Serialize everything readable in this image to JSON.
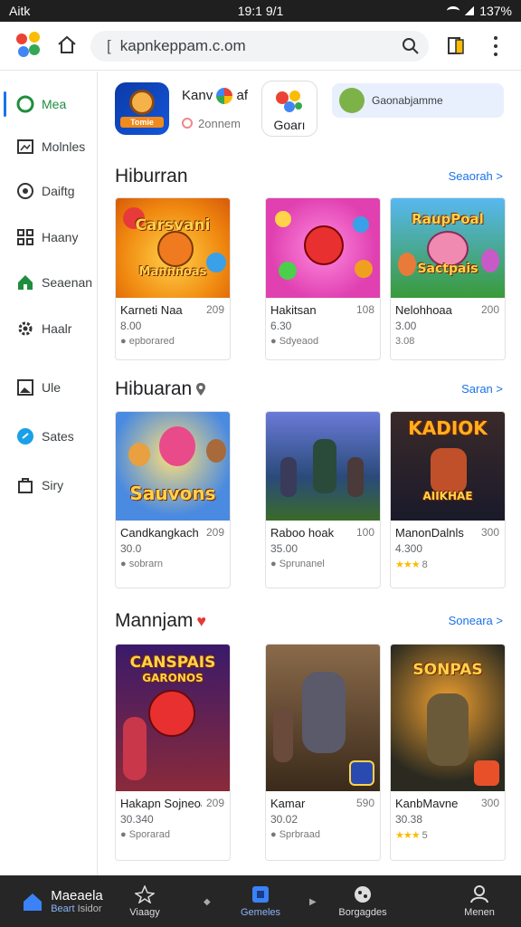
{
  "status": {
    "left": "Aitk",
    "time": "19:1 9/1",
    "battery": "137%"
  },
  "browser": {
    "url": "kapnkeppam.c.om",
    "url_cursor": "["
  },
  "sidebar": {
    "items": [
      {
        "label": "Mea",
        "icon": "circle-icon",
        "active": true
      },
      {
        "label": "Molnles",
        "icon": "image-icon"
      },
      {
        "label": "Daiftg",
        "icon": "target-icon"
      },
      {
        "label": "Haany",
        "icon": "grid-icon"
      },
      {
        "label": "Seaenan",
        "icon": "house-icon"
      },
      {
        "label": "Haalr",
        "icon": "gear-icon"
      },
      {
        "label": "Ule",
        "icon": "photo-icon"
      },
      {
        "label": "Sates",
        "icon": "blue-dot-icon"
      },
      {
        "label": "Siry",
        "icon": "bag-icon"
      }
    ]
  },
  "featured": {
    "app1_label": "Tomie",
    "title": "Kanv",
    "title_suffix": "af",
    "subtitle": "2onnem",
    "app2_label": "Goarı",
    "chip_text": "Gaonabjamme"
  },
  "sections": [
    {
      "title": "Hiburran",
      "link": "Seaorah >",
      "cards": [
        {
          "art_title": "Carsvani",
          "art_sub": "Mannnoas",
          "name": "Karneti Naa",
          "rank": "209",
          "price": "8.00",
          "tag": "● epborared",
          "bg": "#f4a014"
        },
        {
          "art_title": "",
          "art_sub": "",
          "name": "Hakitsan",
          "rank": "108",
          "price": "6.30",
          "tag": "● Sdyeaod",
          "bg": "#ee58c4"
        },
        {
          "art_title": "RaupPoal",
          "art_sub": "Sactpais",
          "name": "Nelohhoaa",
          "rank": "200",
          "price": "3.00",
          "tag": "3.08",
          "bg": "#48a8e0"
        }
      ]
    },
    {
      "title": "Hibuaran",
      "link": "Saran >",
      "cards": [
        {
          "art_title": "",
          "art_sub": "Sauvons",
          "name": "Candkangkach",
          "rank": "209",
          "price": "30.0",
          "tag": "● sobrarn",
          "bg": "#5b9be6"
        },
        {
          "art_title": "",
          "art_sub": "",
          "name": "Raboo hoak",
          "rank": "100",
          "price": "35.00",
          "tag": "● Sprunanel",
          "bg": "#3c6fb0"
        },
        {
          "art_title": "KADIOK",
          "art_sub": "AIIKHAE",
          "name": "ManonDalnls",
          "rank": "300",
          "price": "4.300",
          "tag": "8",
          "stars": "★★★",
          "bg": "#2a2a3a"
        }
      ]
    },
    {
      "title": "Mannjam",
      "link": "Soneara >",
      "cards": [
        {
          "art_title": "CANSPAIS",
          "art_sub": "GARONOS",
          "name": "Hakapn Sojneoakt",
          "rank": "209",
          "price": "30.340",
          "tag": "● Sporarad",
          "bg": "#4a1e6a"
        },
        {
          "art_title": "",
          "art_sub": "",
          "name": "Kamar",
          "rank": "590",
          "price": "30.02",
          "tag": "● Sprbraad",
          "bg": "#6a4a2a"
        },
        {
          "art_title": "SONPAS",
          "art_sub": "",
          "name": "KanbMavne",
          "rank": "300",
          "price": "30.38",
          "tag": "5",
          "stars": "★★★",
          "bg": "#2c2a20"
        }
      ]
    }
  ],
  "bottom_nav": {
    "items": [
      {
        "label": "Beart",
        "extra": "Isidor",
        "top": "Maeaela",
        "active": true
      },
      {
        "label": "Viaagy"
      },
      {
        "label": "Gemeles",
        "active": true
      },
      {
        "label": "Borgagdes"
      },
      {
        "label": "Menen"
      }
    ]
  }
}
